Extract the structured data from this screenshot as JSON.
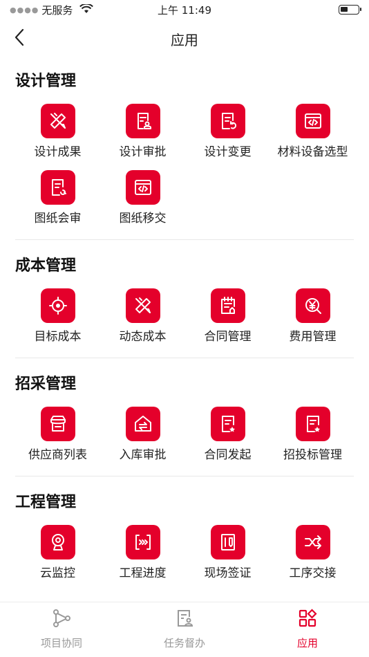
{
  "status_bar": {
    "carrier": "无服务",
    "time": "上午 11:49"
  },
  "nav": {
    "title": "应用"
  },
  "sections": [
    {
      "title": "设计管理",
      "apps": [
        {
          "label": "设计成果",
          "icon": "pencil-ruler-icon"
        },
        {
          "label": "设计审批",
          "icon": "document-approve-icon"
        },
        {
          "label": "设计变更",
          "icon": "document-change-icon"
        },
        {
          "label": "材料设备选型",
          "icon": "code-window-icon"
        },
        {
          "label": "图纸会审",
          "icon": "document-review-icon"
        },
        {
          "label": "图纸移交",
          "icon": "code-window-icon"
        }
      ]
    },
    {
      "title": "成本管理",
      "apps": [
        {
          "label": "目标成本",
          "icon": "target-icon"
        },
        {
          "label": "动态成本",
          "icon": "pencil-ruler-icon"
        },
        {
          "label": "合同管理",
          "icon": "contract-icon"
        },
        {
          "label": "费用管理",
          "icon": "yen-search-icon"
        }
      ]
    },
    {
      "title": "招采管理",
      "apps": [
        {
          "label": "供应商列表",
          "icon": "store-icon"
        },
        {
          "label": "入库审批",
          "icon": "warehouse-icon"
        },
        {
          "label": "合同发起",
          "icon": "document-star-icon"
        },
        {
          "label": "招投标管理",
          "icon": "document-star-icon"
        }
      ]
    },
    {
      "title": "工程管理",
      "apps": [
        {
          "label": "云监控",
          "icon": "camera-icon"
        },
        {
          "label": "工程进度",
          "icon": "progress-icon"
        },
        {
          "label": "现场签证",
          "icon": "site-visa-icon"
        },
        {
          "label": "工序交接",
          "icon": "shuffle-icon"
        }
      ]
    }
  ],
  "tabs": [
    {
      "label": "项目协同",
      "icon": "share-nodes-icon",
      "active": false
    },
    {
      "label": "任务督办",
      "icon": "task-icon",
      "active": false
    },
    {
      "label": "应用",
      "icon": "apps-grid-icon",
      "active": true
    }
  ],
  "colors": {
    "accent": "#E4002B",
    "inactive": "#999999"
  }
}
